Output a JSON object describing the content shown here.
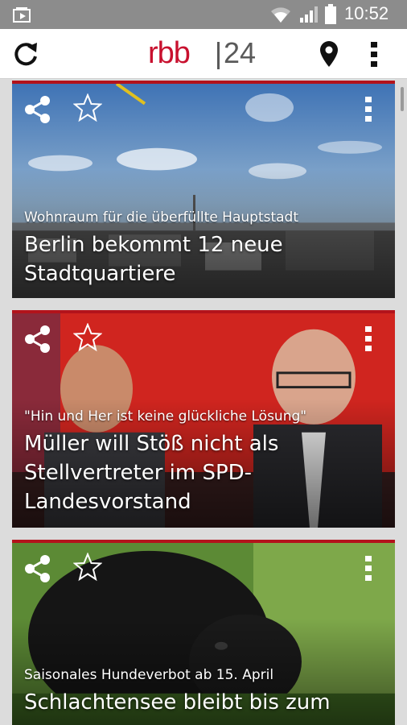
{
  "status_bar": {
    "time": "10:52",
    "icons": [
      "notification-video-icon",
      "wifi-icon",
      "signal-icon",
      "battery-icon"
    ]
  },
  "app_bar": {
    "logo_brand": "rbb",
    "logo_channel": "24",
    "icons": [
      "refresh-icon",
      "location-pin-icon",
      "overflow-menu-icon"
    ],
    "brand_color": "#c8102e"
  },
  "articles": [
    {
      "kicker": "Wohnraum für die überfüllte Hauptstadt",
      "headline": "Berlin bekommt 12 neue Stadtquartiere",
      "icons": [
        "share-icon",
        "star-icon",
        "more-vert-icon"
      ]
    },
    {
      "kicker": "\"Hin und Her ist keine glückliche Lösung\"",
      "headline": "Müller will Stöß nicht als Stellvertreter im SPD-Landesvorstand",
      "icons": [
        "share-icon",
        "star-icon",
        "more-vert-icon"
      ]
    },
    {
      "kicker": "Saisonales Hundeverbot ab 15. April",
      "headline": "Schlachtensee bleibt bis zum",
      "icons": [
        "share-icon",
        "star-icon",
        "more-vert-icon"
      ]
    }
  ],
  "accent_color": "#b3131b"
}
